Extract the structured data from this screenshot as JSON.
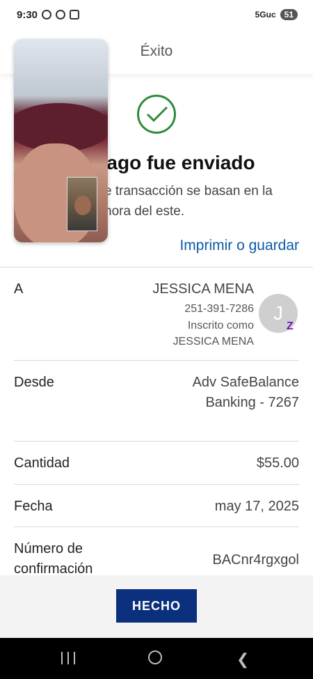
{
  "status_bar": {
    "time": "9:30",
    "network": "5Guc",
    "battery": "51"
  },
  "header": {
    "title": "Éxito"
  },
  "success": {
    "title": "ago fue enviado",
    "note_line1": "e transacción se basan en la",
    "note_line2": "hora del este.",
    "print_link": "Imprimir o guardar"
  },
  "recipient": {
    "label": "A",
    "name": "JESSICA MENA",
    "phone": "251-391-7286",
    "enrolled_as": "Inscrito como",
    "enrolled_name": "JESSICA MENA",
    "avatar_initial": "J",
    "badge": "Z"
  },
  "from": {
    "label": "Desde",
    "line1": "Adv SafeBalance",
    "line2": "Banking - 7267"
  },
  "amount": {
    "label": "Cantidad",
    "value": "$55.00"
  },
  "date": {
    "label": "Fecha",
    "value": "may 17, 2025"
  },
  "confirmation": {
    "label": "Número de confirmación",
    "value": "BACnr4rgxgol"
  },
  "actions": {
    "done": "HECHO"
  },
  "colors": {
    "primary": "#0a2f7c",
    "success": "#2e8b3a",
    "link": "#0b5aa8",
    "zelle": "#6a1bb5"
  }
}
